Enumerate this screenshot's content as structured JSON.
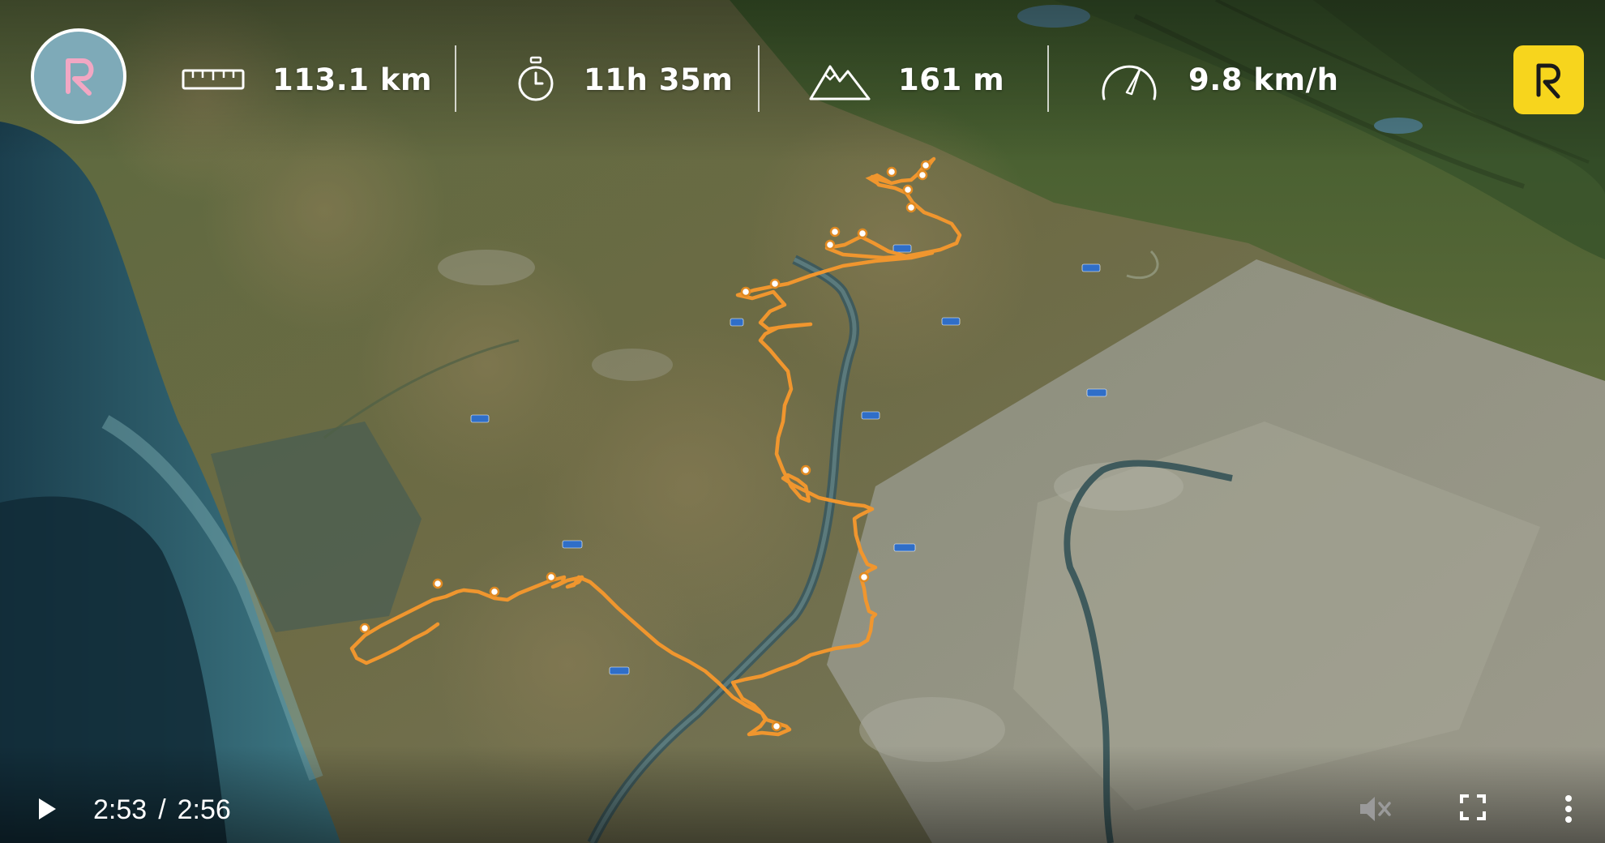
{
  "stats": {
    "distance": "113.1 km",
    "duration": "11h 35m",
    "elevation": "161 m",
    "speed": "9.8 km/h"
  },
  "player": {
    "current_time": "2:53",
    "separator": "/",
    "total_time": "2:56"
  },
  "icons": {
    "logo": "relive-logo-icon",
    "distance": "ruler-icon",
    "duration": "stopwatch-icon",
    "elevation": "mountain-icon",
    "speed": "speedometer-icon",
    "play": "play-icon",
    "mute": "volume-muted-icon",
    "fullscreen": "fullscreen-icon",
    "more": "more-vertical-icon"
  },
  "colors": {
    "route": "#f0962e",
    "logo_bg": "#7eaab8",
    "brand_yellow": "#f7d51d",
    "logo_mark": "#f2a7c3"
  }
}
